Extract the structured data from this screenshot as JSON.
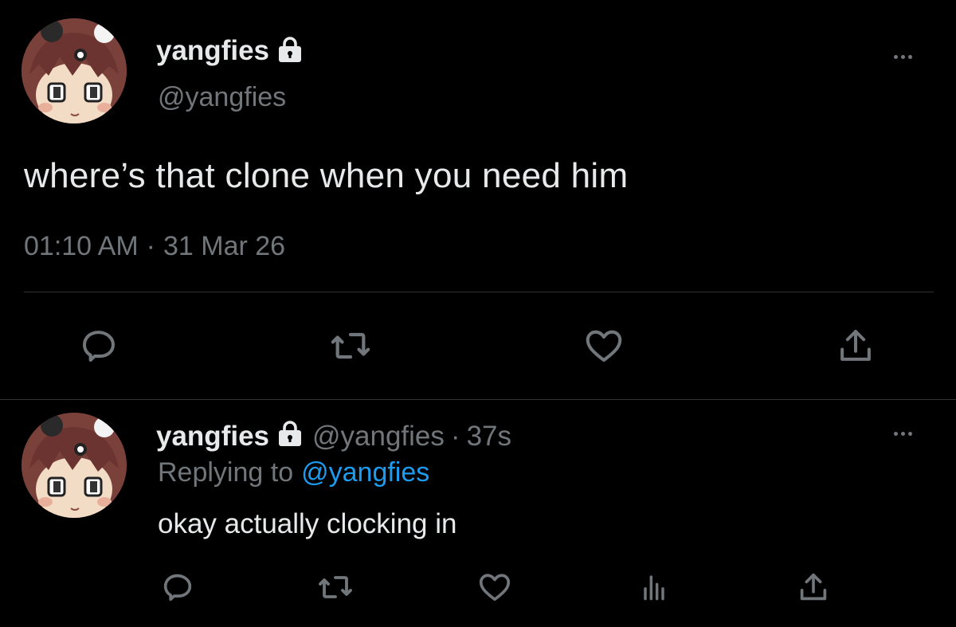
{
  "colors": {
    "background": "#000000",
    "text_primary": "#e7e9ea",
    "text_muted": "#71767b",
    "link": "#1d9bf0",
    "divider": "#2f3336"
  },
  "main_tweet": {
    "display_name": "yangfies",
    "handle": "@yangfies",
    "text": "where’s that clone when you need him",
    "time": "01:10 AM",
    "separator": "·",
    "date": "31 Mar 26",
    "icons": [
      "protected-lock-icon",
      "more-icon",
      "reply-icon",
      "retweet-icon",
      "like-icon",
      "share-icon"
    ]
  },
  "reply_tweet": {
    "display_name": "yangfies",
    "handle": "@yangfies",
    "separator": "·",
    "age": "37s",
    "replying_prefix": "Replying to",
    "replying_to": "@yangfies",
    "text": "okay actually clocking in",
    "icons": [
      "protected-lock-icon",
      "more-icon",
      "reply-icon",
      "retweet-icon",
      "like-icon",
      "analytics-icon",
      "share-icon"
    ]
  }
}
